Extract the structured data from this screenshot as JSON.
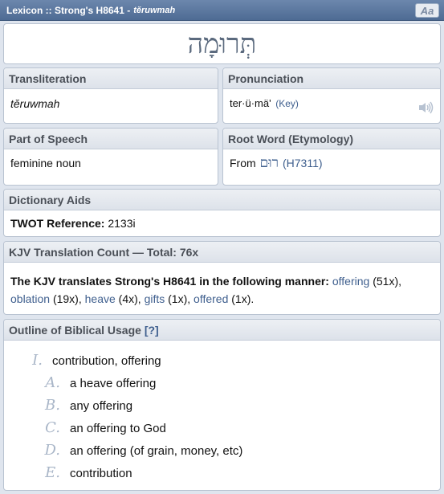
{
  "window": {
    "title_prefix": "Lexicon :: Strong's H8641 - ",
    "title_translit": "tĕruwmah",
    "font_button": "Aa"
  },
  "word": {
    "hebrew": "תְּרוּמָה"
  },
  "transliteration": {
    "header": "Transliteration",
    "value": "tĕruwmah"
  },
  "pronunciation": {
    "header": "Pronunciation",
    "value": "ter·ü·mä'",
    "key_link": "(Key)",
    "icon": "speaker-icon"
  },
  "part_of_speech": {
    "header": "Part of Speech",
    "value": "feminine noun"
  },
  "root_word": {
    "header": "Root Word (Etymology)",
    "prefix": "From",
    "hebrew": "רוּם",
    "ref": "(H7311)"
  },
  "dictionary_aids": {
    "header": "Dictionary Aids",
    "twot_label": "TWOT Reference:",
    "twot_value": "2133i"
  },
  "kjv": {
    "header": "KJV Translation Count — Total: 76x",
    "intro": "The KJV translates Strong's H8641 in the following manner:",
    "items": [
      {
        "word": "offering",
        "count": "(51x),"
      },
      {
        "word": "oblation",
        "count": "(19x),"
      },
      {
        "word": "heave",
        "count": "(4x),"
      },
      {
        "word": "gifts",
        "count": "(1x),"
      },
      {
        "word": "offered",
        "count": "(1x)."
      }
    ]
  },
  "outline": {
    "header": "Outline of Biblical Usage",
    "help": "[?]",
    "items": [
      {
        "mark": "I.",
        "text": "contribution, offering",
        "level": 1
      },
      {
        "mark": "A.",
        "text": "a heave offering",
        "level": 2
      },
      {
        "mark": "B.",
        "text": "any offering",
        "level": 2
      },
      {
        "mark": "C.",
        "text": "an offering to God",
        "level": 2
      },
      {
        "mark": "D.",
        "text": "an offering (of grain, money, etc)",
        "level": 2
      },
      {
        "mark": "E.",
        "text": "contribution",
        "level": 2
      }
    ]
  }
}
